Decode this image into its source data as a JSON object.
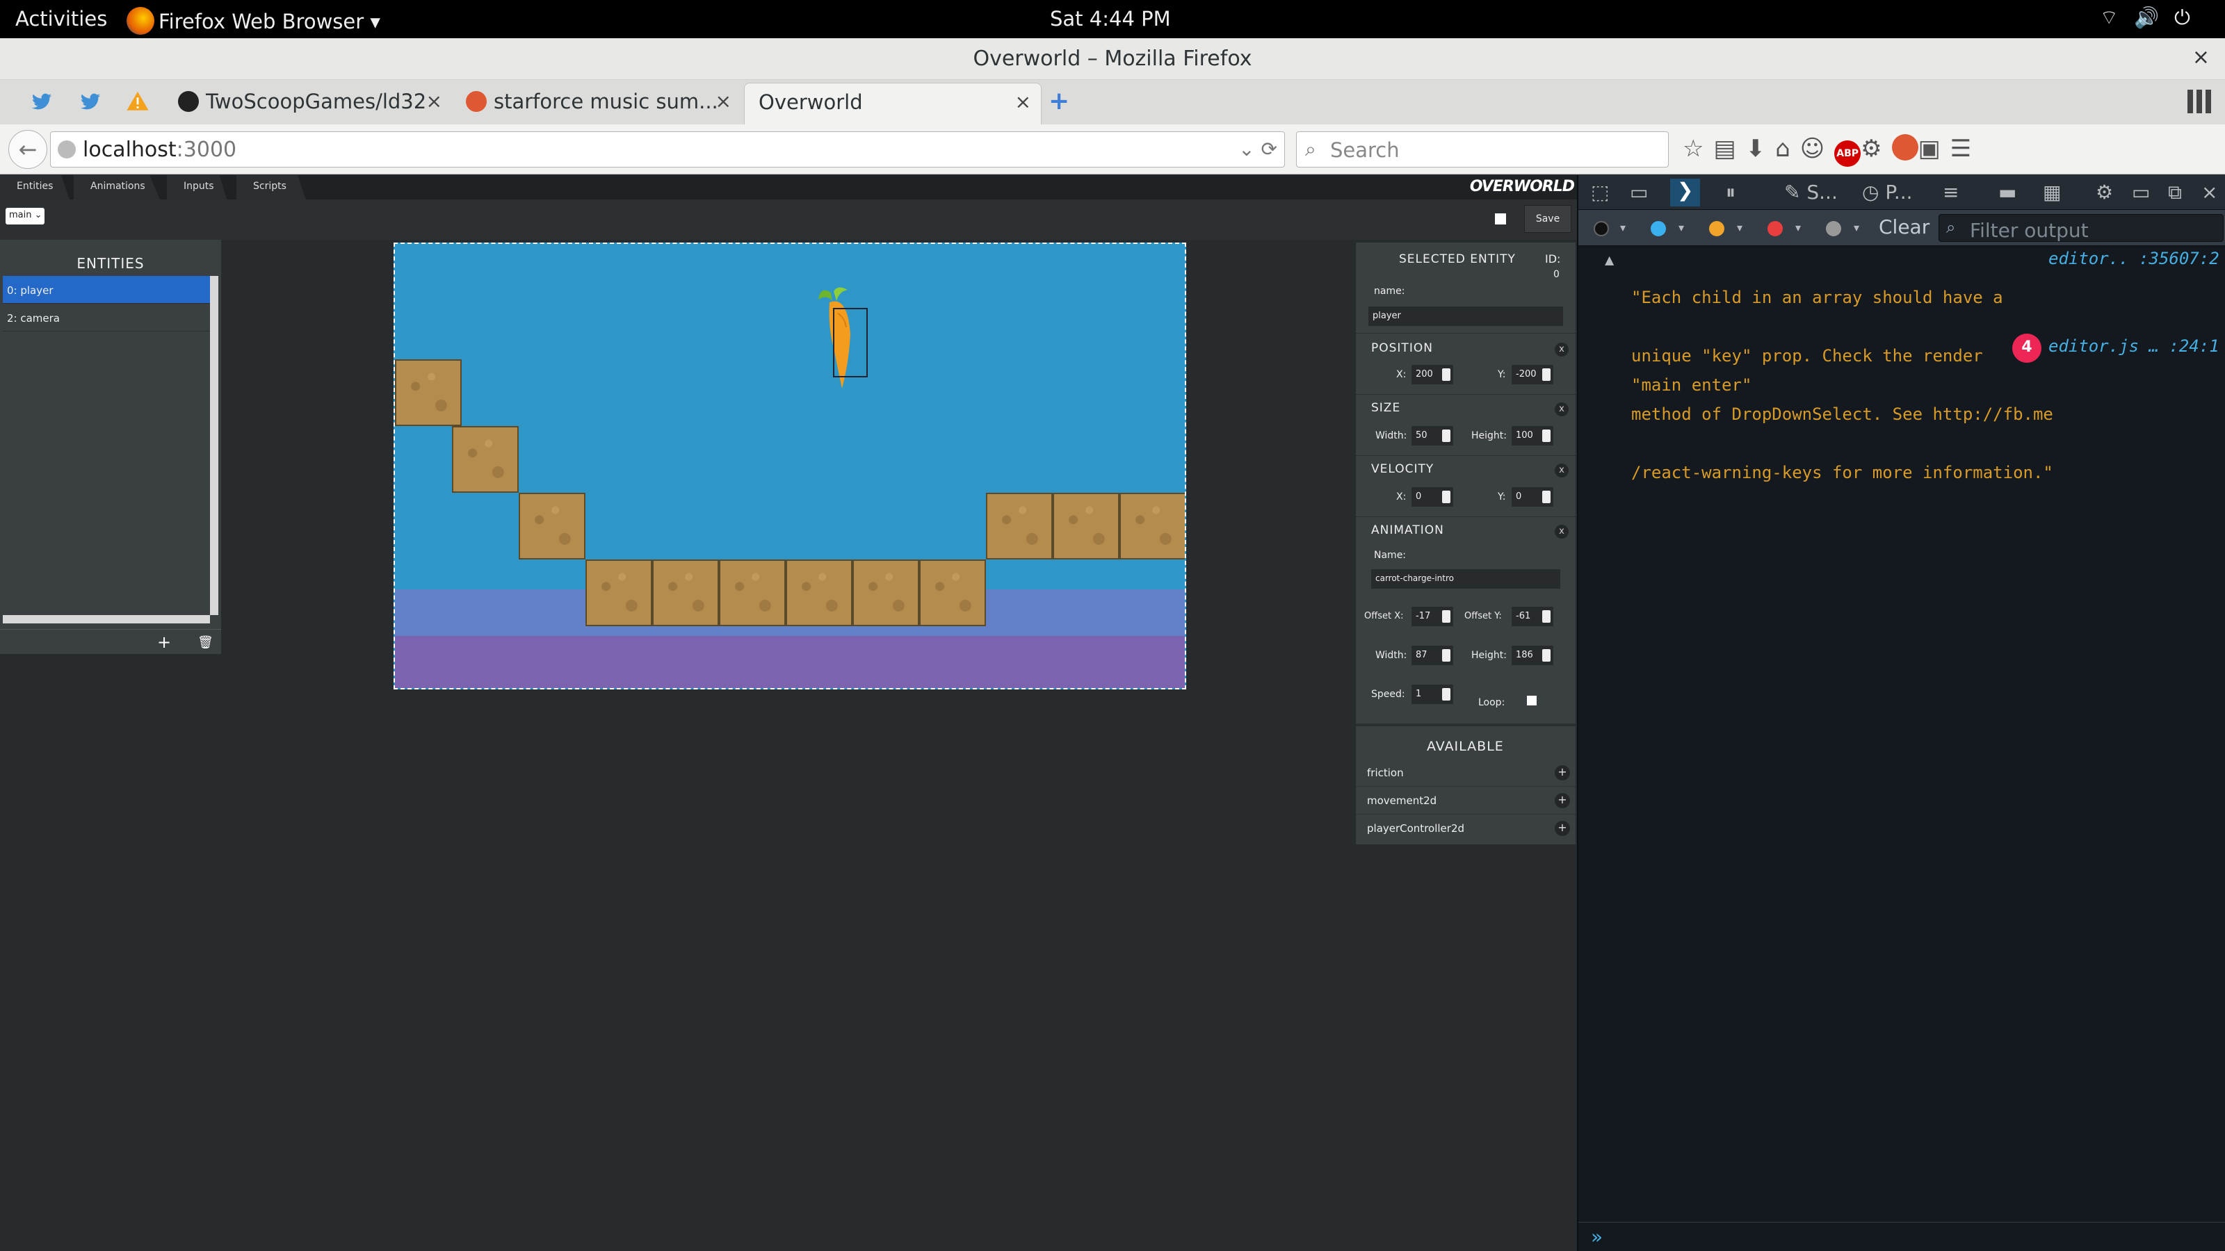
{
  "system": {
    "activities": "Activities",
    "app_name": "Firefox Web Browser",
    "clock": "Sat  4:44 PM"
  },
  "browser": {
    "window_title": "Overworld – Mozilla Firefox",
    "tabs": [
      {
        "label": "TwoScoopGames/ld32"
      },
      {
        "label": "starforce music sum..."
      },
      {
        "label": "Overworld"
      }
    ],
    "url_host": "localhost",
    "url_port": ":3000",
    "search_placeholder": "Search"
  },
  "editor": {
    "brand": "OVERWORLD",
    "menu": [
      "Entities",
      "Animations",
      "Inputs",
      "Scripts"
    ],
    "scene": "main",
    "save_label": "Save",
    "entities_header": "ENTITIES",
    "entities": [
      "0: player",
      "2: camera"
    ],
    "add_icon": "+",
    "delete_icon": "🗑",
    "inspector": {
      "header": "SELECTED ENTITY",
      "id_label": "ID:",
      "id_value": "0",
      "name_label": "name:",
      "name_value": "player",
      "position": {
        "title": "POSITION",
        "x_label": "X:",
        "x": "200",
        "y_label": "Y:",
        "y": "-200"
      },
      "size": {
        "title": "SIZE",
        "width_label": "Width:",
        "width": "50",
        "height_label": "Height:",
        "height": "100"
      },
      "velocity": {
        "title": "VELOCITY",
        "x_label": "X:",
        "x": "0",
        "y_label": "Y:",
        "y": "0"
      },
      "animation": {
        "title": "ANIMATION",
        "name_label": "Name:",
        "name_value": "carrot-charge-intro",
        "offset_x_label": "Offset X:",
        "offset_x": "-17",
        "offset_y_label": "Offset Y:",
        "offset_y": "-61",
        "width_label": "Width:",
        "width": "87",
        "height_label": "Height:",
        "height": "186",
        "speed_label": "Speed:",
        "speed": "1",
        "loop_label": "Loop:"
      },
      "remove_icon": "x",
      "available_header": "AVAILABLE",
      "available": [
        "friction",
        "movement2d",
        "playerController2d"
      ]
    }
  },
  "devtools": {
    "tool_labels": {
      "style": "S...",
      "perf": "P..."
    },
    "clear_label": "Clear",
    "filter_placeholder": "Filter output",
    "messages": [
      {
        "lines": [
          "\"Each child in an array should have a",
          "unique \"key\" prop. Check the render",
          "method of DropDownSelect. See http://fb.me",
          "/react-warning-keys for more information.\""
        ],
        "source": "editor.. :35607:2"
      },
      {
        "lines": [
          "\"main enter\""
        ],
        "repeat": "4",
        "source": "editor.js … :24:1"
      }
    ],
    "prompt": "»"
  }
}
